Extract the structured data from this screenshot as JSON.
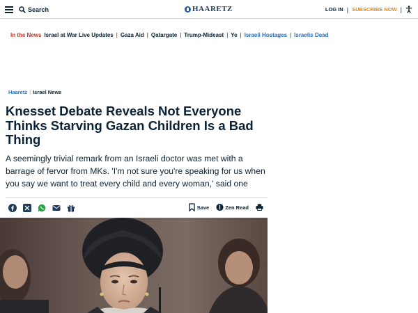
{
  "header": {
    "search_label": "Search",
    "logo_text": "HAARETZ",
    "login_label": "LOG IN",
    "subscribe_label": "SUBSCRIBE NOW"
  },
  "news_nav": {
    "label": "In the News",
    "items": [
      {
        "label": "Israel at War Live Updates"
      },
      {
        "label": "Gaza Aid"
      },
      {
        "label": "Qatargate"
      },
      {
        "label": "Trump-Mideast"
      },
      {
        "label": "Ye"
      },
      {
        "label": "Israeli Hostages"
      },
      {
        "label": "Israelis Dead"
      }
    ]
  },
  "breadcrumb": {
    "home": "Haaretz",
    "section": "Israel News"
  },
  "article": {
    "headline": "Knesset Debate Reveals Not Everyone Thinks Starving Gazan Children Is a Bad Thing",
    "dek": "A seemingly trivial remark from an Israeli doctor was met with a barrage of fervor from MKs. 'I'm not sure you're speaking for us when you say we want to treat every child and every woman,' said one"
  },
  "share": {
    "icons": [
      "facebook-icon",
      "x-icon",
      "whatsapp-icon",
      "email-icon",
      "gift-icon"
    ],
    "save_label": "Save",
    "zen_label": "Zen Read"
  },
  "colors": {
    "brand": "#1c3b5a",
    "accent_orange": "#e8870c",
    "news_label_red": "#c0392b",
    "link_blue": "#2a6ebb"
  }
}
